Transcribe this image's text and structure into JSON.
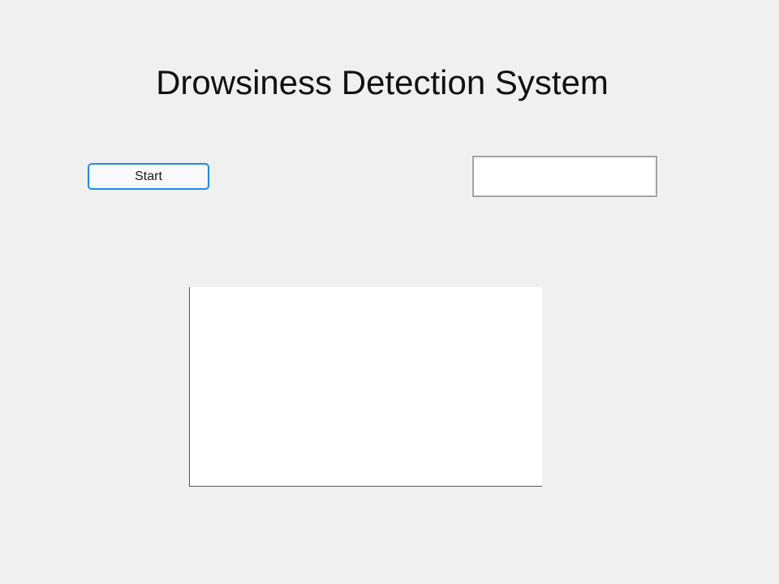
{
  "window": {
    "title": "Drowsiness Detection System"
  },
  "controls": {
    "start_label": "Start",
    "status_value": ""
  },
  "colors": {
    "background": "#f0f0f0",
    "button_border": "#1a8cf0",
    "field_border": "#a3a3a3",
    "axes_background": "#ffffff"
  }
}
